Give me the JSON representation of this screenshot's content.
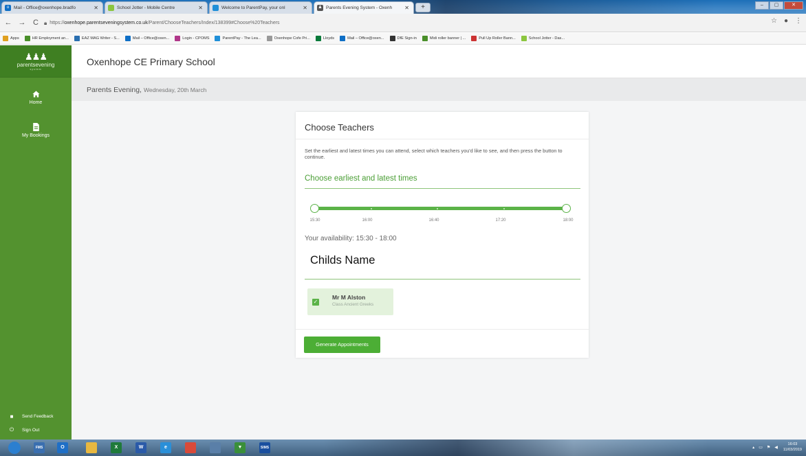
{
  "browser": {
    "tabs": [
      {
        "title": "Mail - Office@oxenhope.bradfo",
        "icon": "outlook-icon",
        "color": "#0f6fc6",
        "active": false
      },
      {
        "title": "School Jotter - Mobile Centre",
        "icon": "jotter-icon",
        "color": "#8cc63f",
        "active": false
      },
      {
        "title": "Welcome to ParentPay, your onl",
        "icon": "parentpay-icon",
        "color": "#1f8fd8",
        "active": false
      },
      {
        "title": "Parents Evening System - Oxenh",
        "icon": "parents-evening-icon",
        "color": "#333333",
        "active": true
      }
    ],
    "new_tab": "+",
    "url_scheme": "https://",
    "url_host": "oxenhope.parentseveningsystem.co.uk",
    "url_path": "/Parent/ChooseTeachers/Index/138399#Choose%20Teachers",
    "bookmarks": [
      {
        "label": "Apps",
        "icon": "apps-icon",
        "color": "#e0a020"
      },
      {
        "label": "HR Employment an...",
        "icon": "hr-icon",
        "color": "#4a8f2a"
      },
      {
        "label": "EAZ MAG Writer - S...",
        "icon": "eaz-icon",
        "color": "#2a6fb0"
      },
      {
        "label": "Mail – Office@oxen...",
        "icon": "outlook-icon",
        "color": "#0f6fc6"
      },
      {
        "label": "Login - CPOMS",
        "icon": "cpoms-icon",
        "color": "#b0378a"
      },
      {
        "label": "ParentPay - The Lea...",
        "icon": "parentpay-icon",
        "color": "#1f8fd8"
      },
      {
        "label": "Oxenhope Cofe Pri...",
        "icon": "school-icon",
        "color": "#999999"
      },
      {
        "label": "Lloyds",
        "icon": "lloyds-icon",
        "color": "#0a7a3a"
      },
      {
        "label": "Mail – Office@oxen...",
        "icon": "outlook-icon",
        "color": "#0f6fc6"
      },
      {
        "label": "DfE Sign-in",
        "icon": "dfe-icon",
        "color": "#333333"
      },
      {
        "label": "Midi roller banner | ...",
        "icon": "banner-icon",
        "color": "#4a8f2a"
      },
      {
        "label": "Pull Up Roller Bann...",
        "icon": "banner2-icon",
        "color": "#c33"
      },
      {
        "label": "School Jotter - Das...",
        "icon": "jotter-icon",
        "color": "#8cc63f"
      }
    ]
  },
  "sidebar": {
    "brand": "parentsevening",
    "brand_sub": "system",
    "items": [
      {
        "label": "Home",
        "icon": "home-icon"
      },
      {
        "label": "My Bookings",
        "icon": "document-icon"
      }
    ],
    "bottom": [
      {
        "label": "Send Feedback",
        "icon": "feedback-icon"
      },
      {
        "label": "Sign Out",
        "icon": "power-icon"
      }
    ]
  },
  "header": {
    "school": "Oxenhope CE Primary School",
    "event": "Parents Evening,",
    "date": "Wednesday, 20th March"
  },
  "card": {
    "title": "Choose Teachers",
    "description": "Set the earliest and latest times you can attend, select which teachers you'd like to see, and then press the button to continue.",
    "section_title": "Choose earliest and latest times",
    "slider": {
      "ticks": [
        "15:30",
        "16:00",
        "16:40",
        "17:20",
        "18:00"
      ],
      "earliest": "15:30",
      "latest": "18:00"
    },
    "availability": "Your availability: 15:30 - 18:00",
    "child_name": "Childs Name",
    "teachers": [
      {
        "name": "Mr M Alston",
        "class": "Class Ancient Greeks",
        "checked": true
      }
    ],
    "button": "Generate Appointments"
  },
  "taskbar": {
    "apps": [
      {
        "name": "start-orb-icon",
        "color": "#2b7fd0",
        "label": ""
      },
      {
        "name": "fms-icon",
        "color": "#3a6fb0",
        "label": "FMS"
      },
      {
        "name": "outlook-icon",
        "color": "#1f6fc6",
        "label": "O"
      },
      {
        "name": "explorer-icon",
        "color": "#e8b840",
        "label": ""
      },
      {
        "name": "excel-icon",
        "color": "#1f7a3a",
        "label": "X"
      },
      {
        "name": "word-icon",
        "color": "#2a5aa8",
        "label": "W"
      },
      {
        "name": "ie-icon",
        "color": "#2a8fd8",
        "label": "e"
      },
      {
        "name": "chrome-icon",
        "color": "#d84a3a",
        "label": ""
      },
      {
        "name": "sims-person-icon",
        "color": "#5a7fa8",
        "label": ""
      },
      {
        "name": "shield-app-icon",
        "color": "#3a8f3a",
        "label": "▼"
      },
      {
        "name": "sims-icon",
        "color": "#1a4f9f",
        "label": "SIMS"
      }
    ],
    "time": "16:03",
    "date": "11/03/2019"
  },
  "colors": {
    "brand_green": "#53922f",
    "accent_green": "#5bb348",
    "button_green": "#4cae35"
  }
}
